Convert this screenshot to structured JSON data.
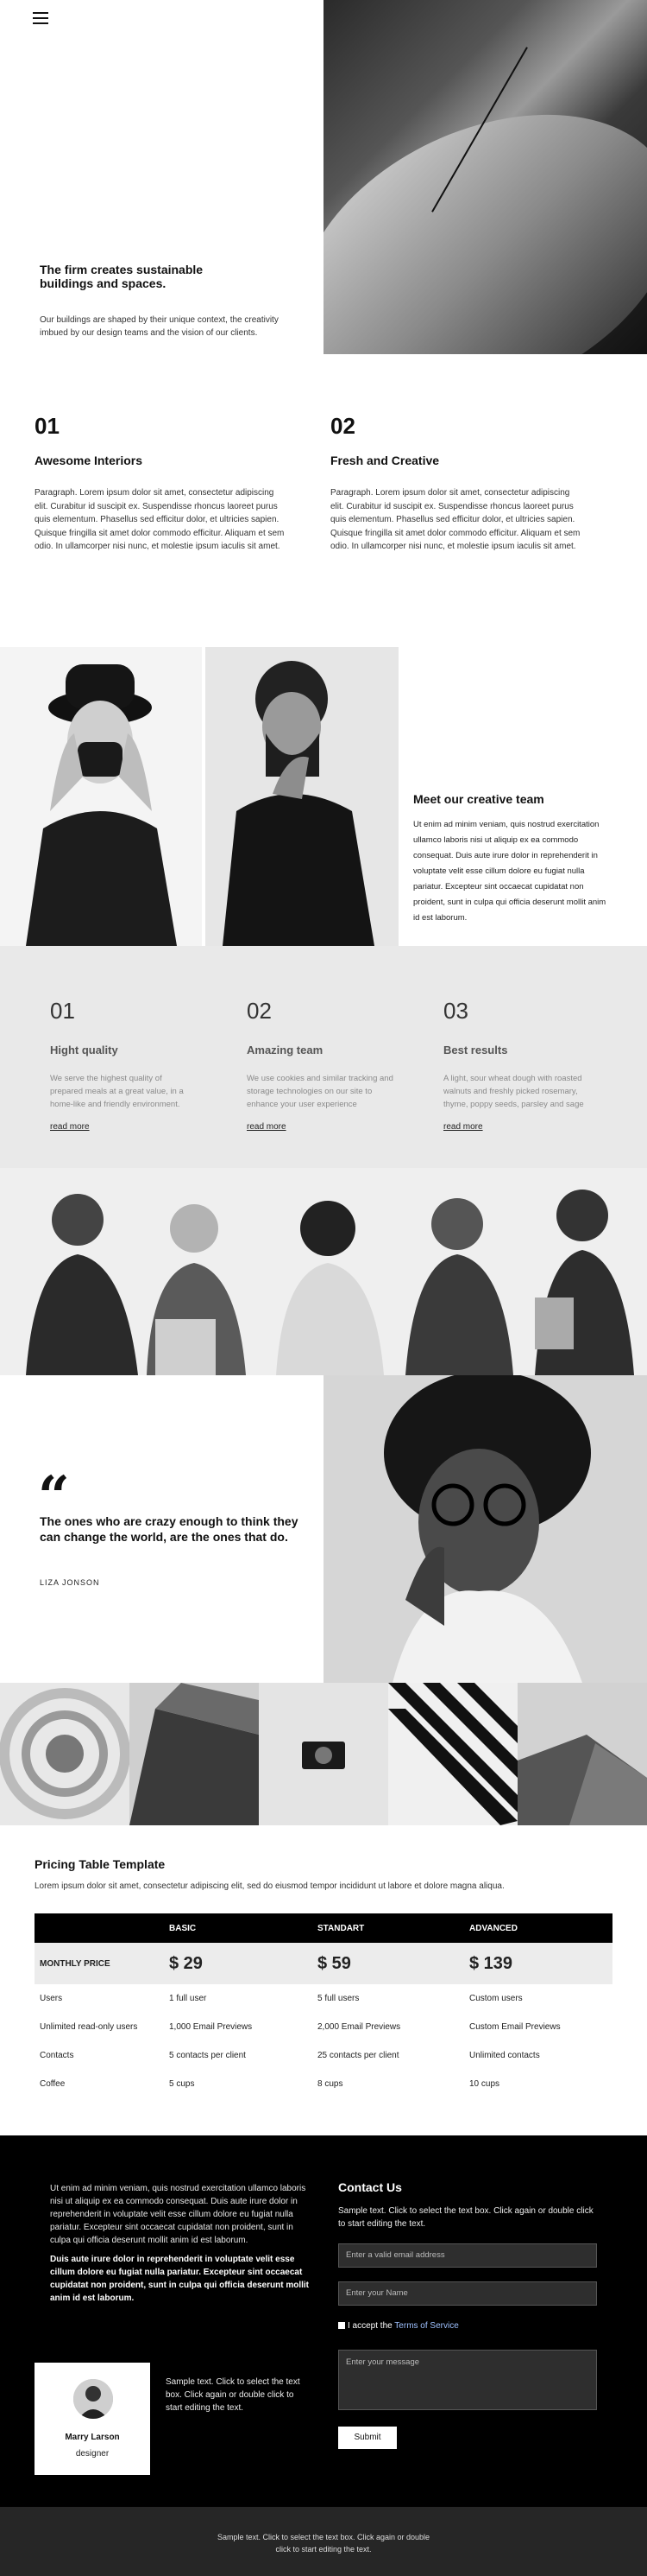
{
  "nav": {
    "menu_icon": "hamburger-icon"
  },
  "hero": {
    "title": "The firm creates sustainable buildings and spaces.",
    "text": "Our buildings are shaped by their unique context, the creativity imbued by our design teams and the vision of our clients."
  },
  "features": [
    {
      "num": "01",
      "title": "Awesome Interiors",
      "text": "Paragraph. Lorem ipsum dolor sit amet, consectetur adipiscing elit. Curabitur id suscipit ex. Suspendisse rhoncus laoreet purus quis elementum. Phasellus sed efficitur dolor, et ultricies sapien. Quisque fringilla sit amet dolor commodo efficitur. Aliquam et sem odio. In ullamcorper nisi nunc, et molestie ipsum iaculis sit amet."
    },
    {
      "num": "02",
      "title": "Fresh and Creative",
      "text": "Paragraph. Lorem ipsum dolor sit amet, consectetur adipiscing elit. Curabitur id suscipit ex. Suspendisse rhoncus laoreet purus quis elementum. Phasellus sed efficitur dolor, et ultricies sapien. Quisque fringilla sit amet dolor commodo efficitur. Aliquam et sem odio. In ullamcorper nisi nunc, et molestie ipsum iaculis sit amet."
    }
  ],
  "team": {
    "heading": "Meet our creative team",
    "text": "Ut enim ad minim veniam, quis nostrud exercitation ullamco laboris nisi ut aliquip ex ea commodo consequat. Duis aute irure dolor in reprehenderit in voluptate velit esse cillum dolore eu fugiat nulla pariatur. Excepteur sint occaecat cupidatat non proident, sunt in culpa qui officia deserunt mollit anim id est laborum."
  },
  "qualities": [
    {
      "num": "01",
      "title": "Hight quality",
      "text": "We serve the highest quality of prepared meals at a great value, in a home-like and friendly environment.",
      "link": "read more"
    },
    {
      "num": "02",
      "title": "Amazing team",
      "text": "We use cookies and similar tracking and storage technologies on our site to enhance your user experience",
      "link": "read more"
    },
    {
      "num": "03",
      "title": "Best results",
      "text": "A light, sour wheat dough with roasted walnuts and freshly picked rosemary, thyme, poppy seeds, parsley and sage",
      "link": "read more"
    }
  ],
  "quote": {
    "mark": "“",
    "text": "The ones who are crazy enough to think they can change the world, are the ones that do.",
    "author": "LIZA JONSON"
  },
  "pricing": {
    "title": "Pricing Table Template",
    "subtitle": "Lorem ipsum dolor sit amet, consectetur adipiscing elit, sed do eiusmod tempor incididunt ut labore et dolore magna aliqua.",
    "plans": [
      "BASIC",
      "STANDART",
      "ADVANCED"
    ],
    "price_label": "MONTHLY PRICE",
    "prices": [
      "$ 29",
      "$ 59",
      "$ 139"
    ],
    "rows": [
      {
        "label": "Users",
        "values": [
          "1 full user",
          "5 full users",
          "Custom users"
        ]
      },
      {
        "label": "Unlimited read-only users",
        "values": [
          "1,000 Email Previews",
          "2,000 Email Previews",
          "Custom Email Previews"
        ]
      },
      {
        "label": "Contacts",
        "values": [
          "5 contacts per client",
          "25 contacts per client",
          "Unlimited contacts"
        ]
      },
      {
        "label": "Coffee",
        "values": [
          "5 cups",
          "8 cups",
          "10 cups"
        ]
      }
    ]
  },
  "footer": {
    "text1": "Ut enim ad minim veniam, quis nostrud exercitation ullamco laboris nisi ut aliquip ex ea commodo consequat. Duis aute irure dolor in reprehenderit in voluptate velit esse cillum dolore eu fugiat nulla pariatur. Excepteur sint occaecat cupidatat non proident, sunt in culpa qui officia deserunt mollit anim id est laborum.",
    "text2": "Duis aute irure dolor in reprehenderit in voluptate velit esse cillum dolore eu fugiat nulla pariatur. Excepteur sint occaecat cupidatat non proident, sunt in culpa qui officia deserunt mollit anim id est laborum.",
    "card": {
      "name": "Marry Larson",
      "role": "designer"
    },
    "sample_text": "Sample text. Click to select the text box. Click again or double click to start editing the text.",
    "contact": {
      "title": "Contact Us",
      "subtitle": "Sample text. Click to select the text box. Click again or double click to start editing the text.",
      "email_placeholder": "Enter a valid email address",
      "name_placeholder": "Enter your Name",
      "checkbox_prefix": "I accept the ",
      "checkbox_link": "Terms of Service",
      "message_placeholder": "Enter your message",
      "submit": "Submit"
    },
    "bottom_text": "Sample text. Click to select the text box. Click again or double click to start editing the text."
  }
}
